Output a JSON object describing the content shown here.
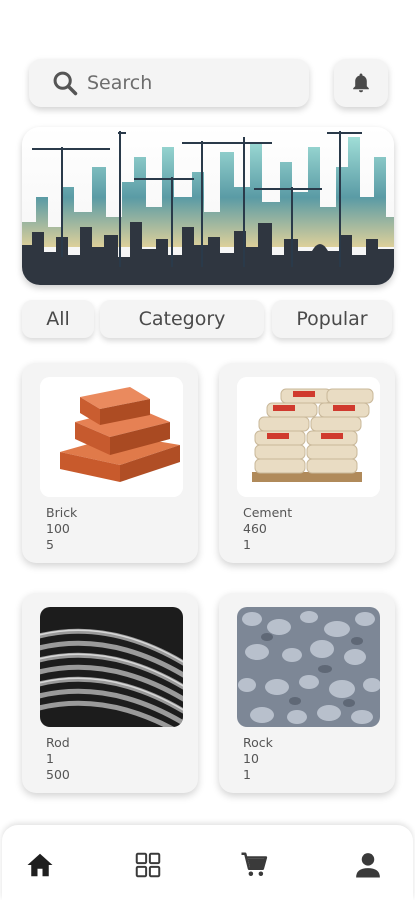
{
  "search": {
    "placeholder": "Search"
  },
  "filters": [
    "All",
    "Category",
    "Popular"
  ],
  "products": [
    {
      "name": "Brick",
      "line2": "100",
      "line3": "5"
    },
    {
      "name": "Cement",
      "line2": "460",
      "line3": "1"
    },
    {
      "name": "Rod",
      "line2": "1",
      "line3": "500"
    },
    {
      "name": "Rock",
      "line2": "10",
      "line3": "1"
    }
  ],
  "icons": {
    "search": "search-icon",
    "notification": "bell-icon",
    "nav": [
      "home-icon",
      "grid-icon",
      "cart-icon",
      "user-icon"
    ]
  },
  "colors": {
    "card_bg": "#f4f4f4",
    "icon": "#3a3a3a"
  }
}
